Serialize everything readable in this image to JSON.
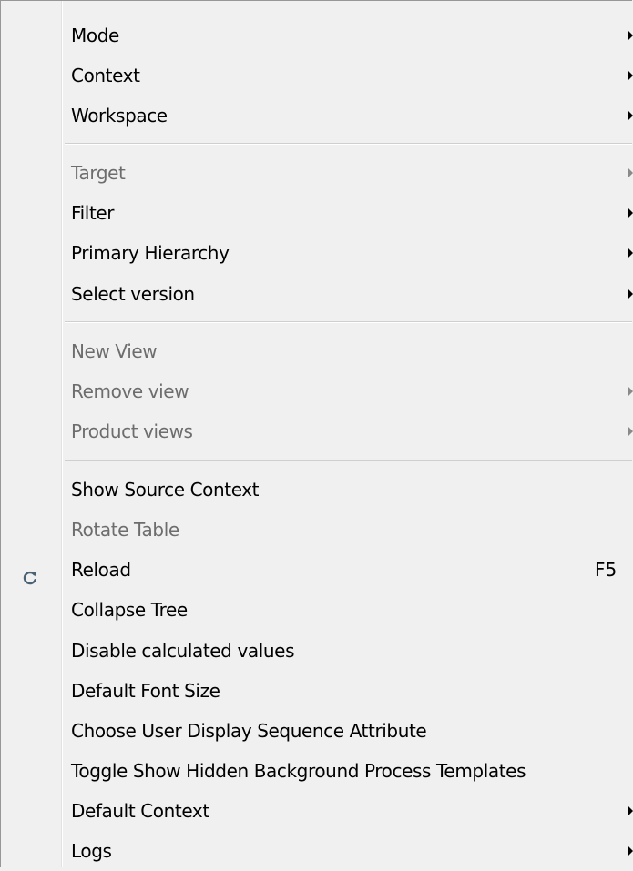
{
  "menu": {
    "items": [
      {
        "label": "Mode",
        "submenu": true,
        "disabled": false
      },
      {
        "label": "Context",
        "submenu": true,
        "disabled": false
      },
      {
        "label": "Workspace",
        "submenu": true,
        "disabled": false
      },
      {
        "label": "Target",
        "submenu": true,
        "disabled": true
      },
      {
        "label": "Filter",
        "submenu": true,
        "disabled": false
      },
      {
        "label": "Primary Hierarchy",
        "submenu": true,
        "disabled": false
      },
      {
        "label": "Select version",
        "submenu": true,
        "disabled": false
      },
      {
        "label": "New View",
        "submenu": false,
        "disabled": true
      },
      {
        "label": "Remove view",
        "submenu": true,
        "disabled": true
      },
      {
        "label": "Product views",
        "submenu": true,
        "disabled": true
      },
      {
        "label": "Show Source Context",
        "submenu": false,
        "disabled": false
      },
      {
        "label": "Rotate Table",
        "submenu": false,
        "disabled": true
      },
      {
        "label": "Reload",
        "submenu": false,
        "disabled": false,
        "shortcut": "F5",
        "icon": "reload-icon"
      },
      {
        "label": "Collapse Tree",
        "submenu": false,
        "disabled": false
      },
      {
        "label": "Disable calculated values",
        "submenu": false,
        "disabled": false
      },
      {
        "label": "Default Font Size",
        "submenu": false,
        "disabled": false
      },
      {
        "label": "Choose User Display Sequence Attribute",
        "submenu": false,
        "disabled": false
      },
      {
        "label": "Toggle Show Hidden Background Process Templates",
        "submenu": false,
        "disabled": false
      },
      {
        "label": "Default Context",
        "submenu": true,
        "disabled": false
      },
      {
        "label": "Logs",
        "submenu": true,
        "disabled": false
      }
    ]
  },
  "colors": {
    "background": "#f0f0f0",
    "text": "#000000",
    "disabled_text": "#6d6d6d",
    "icon": "#4a6274"
  }
}
